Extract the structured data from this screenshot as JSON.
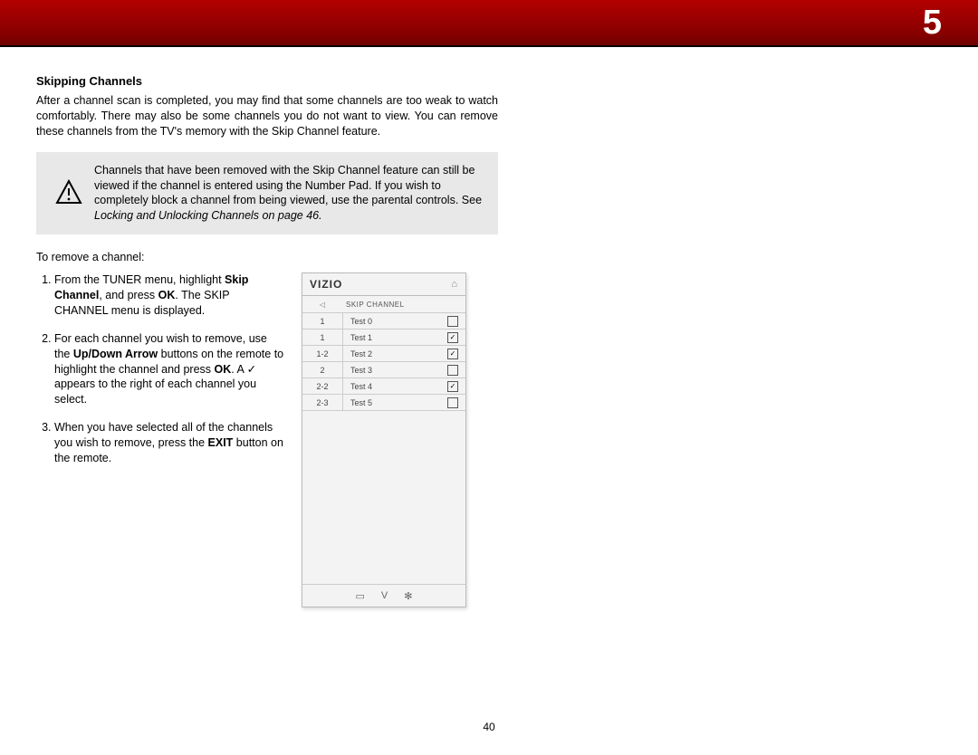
{
  "chapter": "5",
  "page_number": "40",
  "section": {
    "title": "Skipping Channels",
    "body": "After a channel scan is completed, you may find that some channels are too weak to watch comfortably. There may also be some channels you do not want to view. You can remove these channels from the TV's memory with the Skip Channel feature."
  },
  "note": {
    "text_start": "Channels that have been removed with the Skip Channel feature can still be viewed if the channel is entered using the Number Pad. If you wish to completely block a channel from being viewed, use the parental controls. See ",
    "text_italic": "Locking and Unlocking Channels on page 46."
  },
  "instructions": {
    "lead": "To remove a channel:",
    "steps": {
      "s1_a": "From the TUNER menu, highlight ",
      "s1_b": "Skip Channel",
      "s1_c": ", and press ",
      "s1_d": "OK",
      "s1_e": ". The SKIP CHANNEL menu is displayed.",
      "s2_a": "For each channel you wish to remove, use the ",
      "s2_b": "Up/Down Arrow",
      "s2_c": " buttons on the remote to highlight the channel and press ",
      "s2_d": "OK",
      "s2_e": ". A ✓ appears to the right of each channel you select.",
      "s3_a": "When you have selected all of the channels you wish to remove, press the ",
      "s3_b": "EXIT",
      "s3_c": " button on the remote."
    }
  },
  "screenshot": {
    "brand": "VIZIO",
    "menu_title": "SKIP CHANNEL",
    "back_glyph": "◁",
    "home_glyph": "⌂",
    "rows": [
      {
        "num": "1",
        "name": "Test 0",
        "checked": false
      },
      {
        "num": "1",
        "name": "Test 1",
        "checked": true
      },
      {
        "num": "1-2",
        "name": "Test 2",
        "checked": true
      },
      {
        "num": "2",
        "name": "Test 3",
        "checked": false
      },
      {
        "num": "2-2",
        "name": "Test 4",
        "checked": true
      },
      {
        "num": "2-3",
        "name": "Test 5",
        "checked": false
      }
    ],
    "footer": {
      "cc": "▭",
      "v": "V",
      "gear": "✻"
    }
  }
}
